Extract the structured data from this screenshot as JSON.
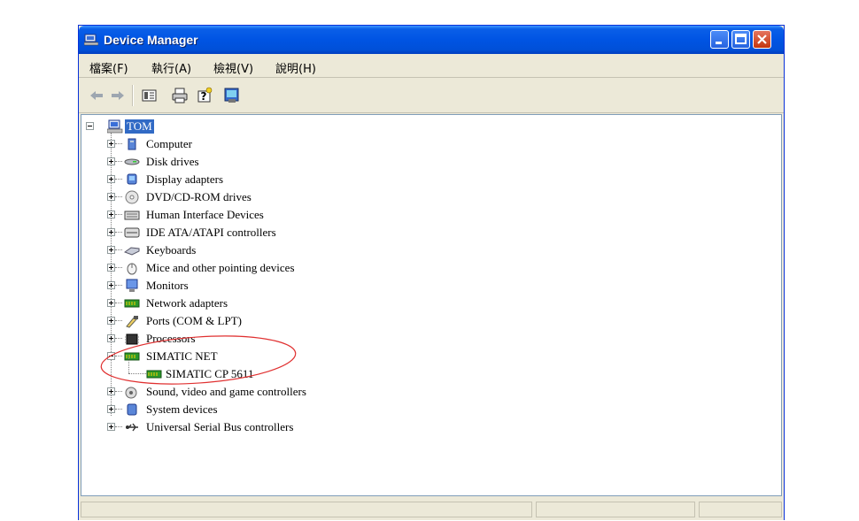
{
  "window": {
    "title": "Device Manager"
  },
  "menu": [
    "檔案(F)",
    "執行(A)",
    "檢視(V)",
    "說明(H)"
  ],
  "toolbar": [
    {
      "name": "back-icon"
    },
    {
      "name": "forward-icon"
    },
    {
      "name": "properties-icon"
    },
    {
      "name": "print-icon"
    },
    {
      "name": "help-icon"
    },
    {
      "name": "scan-hardware-icon"
    }
  ],
  "tree": {
    "root": "TOM",
    "items": [
      {
        "label": "Computer",
        "icon": "computer-icon"
      },
      {
        "label": "Disk drives",
        "icon": "disk-drive-icon"
      },
      {
        "label": "Display adapters",
        "icon": "display-adapter-icon"
      },
      {
        "label": "DVD/CD-ROM drives",
        "icon": "dvd-drive-icon"
      },
      {
        "label": "Human Interface Devices",
        "icon": "hid-icon"
      },
      {
        "label": "IDE ATA/ATAPI controllers",
        "icon": "ide-controller-icon"
      },
      {
        "label": "Keyboards",
        "icon": "keyboard-icon"
      },
      {
        "label": "Mice and other pointing devices",
        "icon": "mouse-icon"
      },
      {
        "label": "Monitors",
        "icon": "monitor-icon"
      },
      {
        "label": "Network adapters",
        "icon": "network-adapter-icon"
      },
      {
        "label": "Ports (COM & LPT)",
        "icon": "port-icon"
      },
      {
        "label": "Processors",
        "icon": "processor-icon"
      },
      {
        "label": "SIMATIC NET",
        "icon": "simatic-net-icon",
        "expanded": true,
        "child": {
          "label": "SIMATIC CP 5611",
          "icon": "simatic-card-icon"
        }
      },
      {
        "label": "Sound, video and game controllers",
        "icon": "sound-icon"
      },
      {
        "label": "System devices",
        "icon": "system-devices-icon"
      },
      {
        "label": "Universal Serial Bus controllers",
        "icon": "usb-icon"
      }
    ]
  },
  "colors": {
    "titlebar": "#0054e3",
    "selection": "#316ac5",
    "annotation": "#e03030"
  }
}
